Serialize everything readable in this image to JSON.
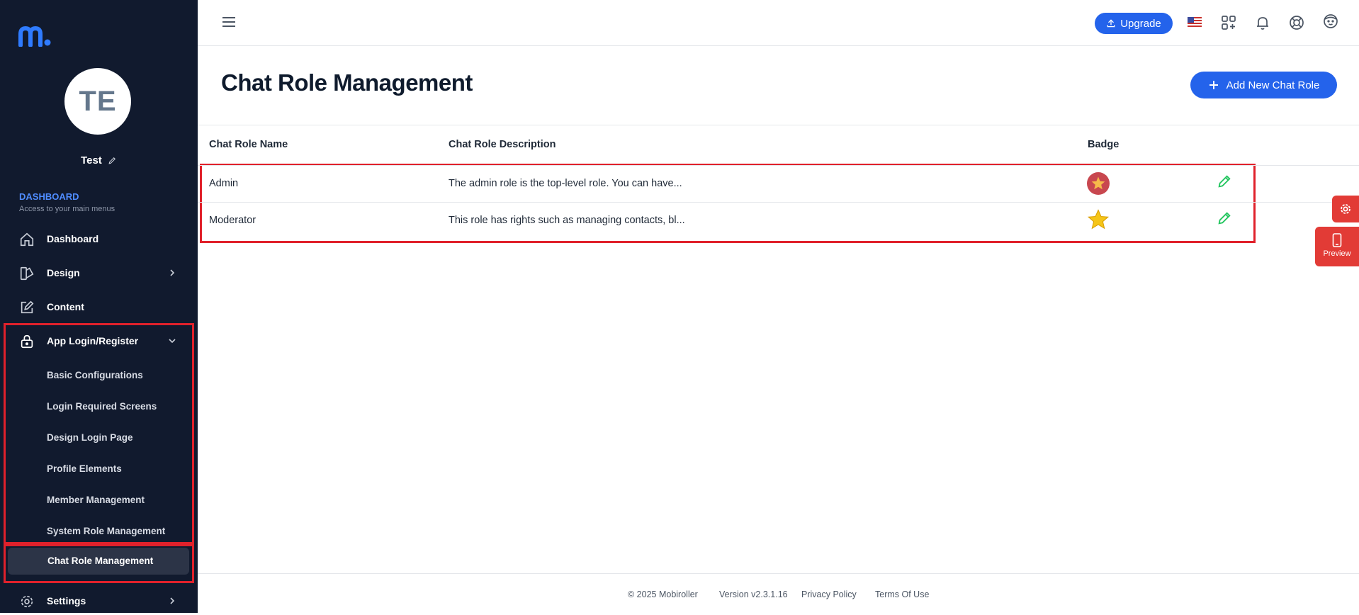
{
  "user": {
    "initials": "TE",
    "name": "Test"
  },
  "sidebar": {
    "section_title": "DASHBOARD",
    "section_subtitle": "Access to your main menus",
    "items": [
      {
        "label": "Dashboard",
        "icon": "home-icon"
      },
      {
        "label": "Design",
        "icon": "palette-icon"
      },
      {
        "label": "Content",
        "icon": "edit-square-icon"
      },
      {
        "label": "App Login/Register",
        "icon": "lock-icon"
      },
      {
        "label": "Settings",
        "icon": "gear-icon"
      }
    ],
    "sub_items": [
      "Basic Configurations",
      "Login Required Screens",
      "Design Login Page",
      "Profile Elements",
      "Member Management",
      "System Role Management",
      "Chat Role Management"
    ]
  },
  "topbar": {
    "upgrade_label": "Upgrade",
    "icons": [
      "menu-icon",
      "us-flag-icon",
      "apps-icon",
      "bell-icon",
      "help-lifebuoy-icon",
      "user-face-icon"
    ]
  },
  "main": {
    "title": "Chat Role Management",
    "add_button_label": "Add New Chat Role",
    "columns": [
      "Chat Role Name",
      "Chat Role Description",
      "Badge"
    ],
    "rows": [
      {
        "name": "Admin",
        "description": "The admin role is the top-level role. You can have...",
        "badge": "star-badge-red-icon"
      },
      {
        "name": "Moderator",
        "description": "This role has rights such as managing contacts, bl...",
        "badge": "star-gold-icon"
      }
    ]
  },
  "floating": {
    "preview_label": "Preview"
  },
  "footer": {
    "copyright": "© 2025 Mobiroller",
    "version": "Version v2.3.1.16",
    "privacy": "Privacy Policy",
    "terms": "Terms Of Use"
  },
  "colors": {
    "sidebar_bg": "#111a2e",
    "accent": "#2463eb",
    "highlight_box": "#e0212b",
    "edit_icon": "#22c55e"
  }
}
